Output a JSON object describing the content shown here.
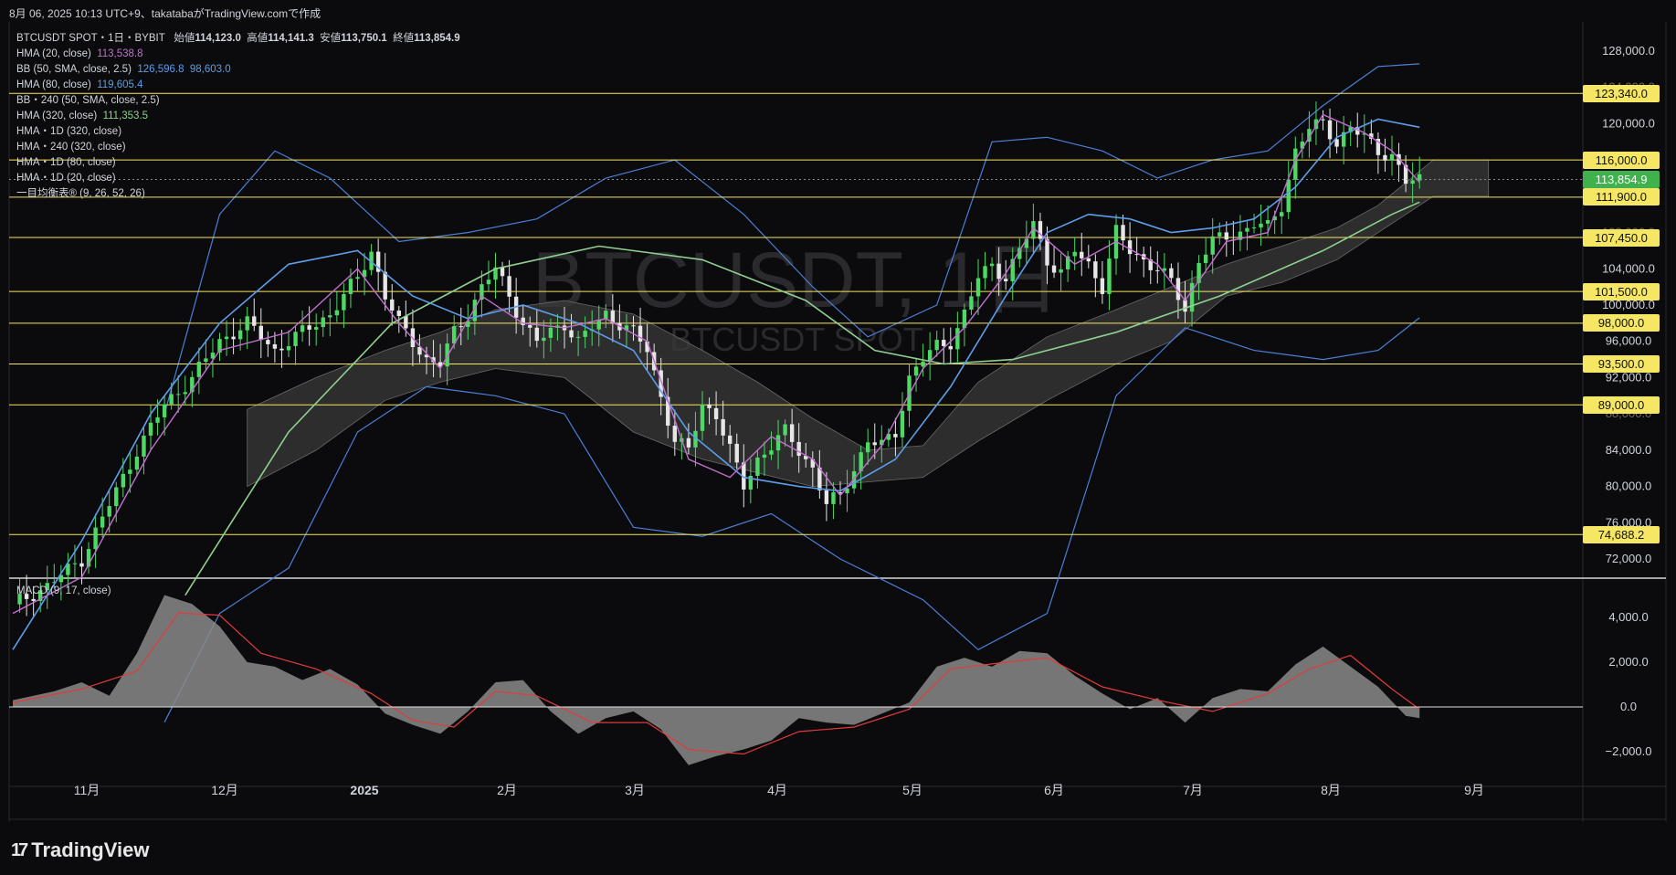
{
  "header": {
    "title": "8月 06, 2025 10:13 UTC+9、takatabaがTradingView.comで作成"
  },
  "symbol": {
    "name": "BTCUSDT SPOT・1日・BYBIT",
    "open_label": "始値",
    "open": "114,123.0",
    "high_label": "高値",
    "high": "114,141.3",
    "low_label": "安値",
    "low": "113,750.1",
    "close_label": "終値",
    "close": "113,854.9"
  },
  "watermark": {
    "main": "BTCUSDT, 1日",
    "sub": "BTCUSDT SPOT"
  },
  "indicators": [
    {
      "label": "HMA (20, close)",
      "value": "113,538.8",
      "color": "#c46fd0"
    },
    {
      "label": "BB (50, SMA, close, 2.5)",
      "value": "126,596.8",
      "value2": "98,603.0",
      "color": "#5c9ee8"
    },
    {
      "label": "HMA (80, close)",
      "value": "119,605.4",
      "color": "#5c9ee8"
    },
    {
      "label": "BB・240 (50, SMA, close, 2.5)",
      "value": ""
    },
    {
      "label": "HMA (320, close)",
      "value": "111,353.5",
      "color": "#8fd18f"
    },
    {
      "label": "HMA・1D (320, close)",
      "value": ""
    },
    {
      "label": "HMA・240 (320, close)",
      "value": ""
    },
    {
      "label": "HMA・1D (80, close)",
      "value": ""
    },
    {
      "label": "HMA・1D (20, close)",
      "value": ""
    },
    {
      "label": "一目均衡表® (9, 26, 52, 26)",
      "value": ""
    }
  ],
  "macd": {
    "label": "MACD (9, 17, close)"
  },
  "branding": {
    "logo": "TradingView",
    "mark": "17"
  },
  "colors": {
    "up": "#4cd964",
    "down": "#e6e6e6",
    "hline": "#f5e663",
    "hma20": "#c46fd0",
    "hma80": "#5c9ee8",
    "hma320": "#8fd18f",
    "bb": "#4b7fd6",
    "cloud": "#3a3a3a",
    "macd_hist": "#8a8a8a",
    "macd_signal": "#e23b3b"
  },
  "chart_data": {
    "type": "candlestick",
    "y_axis_ticks": [
      "128,000.0",
      "120,000.0",
      "104,000.0",
      "100,000.0",
      "96,000.0",
      "92,000.0",
      "84,000.0",
      "80,000.0",
      "76,000.0",
      "72,000.0"
    ],
    "y_axis_partial": [
      "124,000.0",
      "108,000.0",
      "88,000.0"
    ],
    "horizontal_levels": [
      "123,340.0",
      "116,000.0",
      "111,900.0",
      "107,450.0",
      "101,500.0",
      "98,000.0",
      "93,500.0",
      "89,000.0",
      "74,688.2"
    ],
    "current_price": "113,854.9",
    "x_axis_labels": [
      "11月",
      "12月",
      "2025",
      "2月",
      "3月",
      "4月",
      "5月",
      "6月",
      "7月",
      "8月",
      "9月"
    ],
    "macd_ticks": [
      "4,000.0",
      "2,000.0",
      "0.0",
      "−2,000.0"
    ],
    "close_path": [
      [
        0,
        67000
      ],
      [
        5,
        69000
      ],
      [
        10,
        72000
      ],
      [
        14,
        78000
      ],
      [
        18,
        84000
      ],
      [
        22,
        89000
      ],
      [
        26,
        92000
      ],
      [
        30,
        96000
      ],
      [
        34,
        98000
      ],
      [
        38,
        95000
      ],
      [
        42,
        97000
      ],
      [
        46,
        99000
      ],
      [
        50,
        103000
      ],
      [
        52,
        106000
      ],
      [
        54,
        101000
      ],
      [
        56,
        98000
      ],
      [
        58,
        96000
      ],
      [
        60,
        94000
      ],
      [
        62,
        93500
      ],
      [
        64,
        97000
      ],
      [
        66,
        99000
      ],
      [
        68,
        102000
      ],
      [
        70,
        104000
      ],
      [
        72,
        101000
      ],
      [
        74,
        98000
      ],
      [
        76,
        96000
      ],
      [
        78,
        97000
      ],
      [
        80,
        98000
      ],
      [
        82,
        96000
      ],
      [
        84,
        97500
      ],
      [
        86,
        99000
      ],
      [
        88,
        98000
      ],
      [
        90,
        97000
      ],
      [
        92,
        95000
      ],
      [
        94,
        90000
      ],
      [
        96,
        85000
      ],
      [
        98,
        84000
      ],
      [
        100,
        89000
      ],
      [
        102,
        88000
      ],
      [
        104,
        84000
      ],
      [
        106,
        80000
      ],
      [
        108,
        83000
      ],
      [
        110,
        84500
      ],
      [
        112,
        86000
      ],
      [
        114,
        84000
      ],
      [
        116,
        82000
      ],
      [
        118,
        78000
      ],
      [
        120,
        79000
      ],
      [
        122,
        82000
      ],
      [
        124,
        85000
      ],
      [
        126,
        84500
      ],
      [
        128,
        86000
      ],
      [
        130,
        92000
      ],
      [
        132,
        94000
      ],
      [
        134,
        95500
      ],
      [
        136,
        96000
      ],
      [
        138,
        99000
      ],
      [
        140,
        103000
      ],
      [
        142,
        104500
      ],
      [
        144,
        103000
      ],
      [
        146,
        106000
      ],
      [
        148,
        109000
      ],
      [
        150,
        105000
      ],
      [
        152,
        103500
      ],
      [
        154,
        106000
      ],
      [
        156,
        104500
      ],
      [
        158,
        102000
      ],
      [
        160,
        108000
      ],
      [
        162,
        106000
      ],
      [
        164,
        105000
      ],
      [
        166,
        104000
      ],
      [
        168,
        102500
      ],
      [
        170,
        99500
      ],
      [
        172,
        105000
      ],
      [
        174,
        107000
      ],
      [
        176,
        107500
      ],
      [
        178,
        108000
      ],
      [
        180,
        109000
      ],
      [
        182,
        108500
      ],
      [
        184,
        111000
      ],
      [
        186,
        117000
      ],
      [
        188,
        119500
      ],
      [
        190,
        120000
      ],
      [
        192,
        118000
      ],
      [
        194,
        119500
      ],
      [
        196,
        118500
      ],
      [
        198,
        117000
      ],
      [
        200,
        116500
      ],
      [
        202,
        113500
      ],
      [
        204,
        113854.9
      ]
    ],
    "hma20_path": [
      [
        0,
        66000
      ],
      [
        10,
        70000
      ],
      [
        20,
        84000
      ],
      [
        30,
        95000
      ],
      [
        40,
        97000
      ],
      [
        50,
        104000
      ],
      [
        56,
        98000
      ],
      [
        62,
        93000
      ],
      [
        68,
        101000
      ],
      [
        74,
        98000
      ],
      [
        80,
        97500
      ],
      [
        86,
        98500
      ],
      [
        92,
        96000
      ],
      [
        98,
        83000
      ],
      [
        104,
        81000
      ],
      [
        110,
        85500
      ],
      [
        116,
        83000
      ],
      [
        120,
        79000
      ],
      [
        126,
        84500
      ],
      [
        132,
        93000
      ],
      [
        138,
        97500
      ],
      [
        144,
        103500
      ],
      [
        148,
        108500
      ],
      [
        154,
        104500
      ],
      [
        160,
        107000
      ],
      [
        166,
        104500
      ],
      [
        170,
        100500
      ],
      [
        176,
        107000
      ],
      [
        182,
        108000
      ],
      [
        186,
        116000
      ],
      [
        190,
        121000
      ],
      [
        196,
        119000
      ],
      [
        200,
        117000
      ],
      [
        204,
        113538.8
      ]
    ],
    "hma80_path": [
      [
        0,
        62000
      ],
      [
        10,
        74000
      ],
      [
        20,
        88000
      ],
      [
        30,
        98000
      ],
      [
        40,
        104500
      ],
      [
        50,
        106000
      ],
      [
        58,
        101000
      ],
      [
        66,
        98500
      ],
      [
        74,
        100000
      ],
      [
        82,
        98000
      ],
      [
        90,
        95000
      ],
      [
        98,
        86000
      ],
      [
        106,
        81000
      ],
      [
        114,
        80000
      ],
      [
        120,
        79500
      ],
      [
        128,
        83000
      ],
      [
        136,
        91000
      ],
      [
        144,
        101000
      ],
      [
        150,
        108000
      ],
      [
        156,
        110000
      ],
      [
        162,
        109500
      ],
      [
        168,
        108000
      ],
      [
        174,
        108500
      ],
      [
        180,
        109500
      ],
      [
        186,
        113000
      ],
      [
        192,
        118500
      ],
      [
        198,
        120500
      ],
      [
        204,
        119605.4
      ]
    ],
    "hma320_path": [
      [
        25,
        68000
      ],
      [
        40,
        86000
      ],
      [
        55,
        98000
      ],
      [
        70,
        104000
      ],
      [
        85,
        106500
      ],
      [
        100,
        105000
      ],
      [
        115,
        100500
      ],
      [
        125,
        95000
      ],
      [
        135,
        93500
      ],
      [
        145,
        94000
      ],
      [
        160,
        97000
      ],
      [
        175,
        101000
      ],
      [
        190,
        106000
      ],
      [
        200,
        110000
      ],
      [
        204,
        111353.5
      ]
    ],
    "bb_upper": [
      [
        22,
        88000
      ],
      [
        30,
        110000
      ],
      [
        38,
        117000
      ],
      [
        46,
        114000
      ],
      [
        56,
        107000
      ],
      [
        66,
        108000
      ],
      [
        76,
        109500
      ],
      [
        86,
        114000
      ],
      [
        96,
        116000
      ],
      [
        106,
        110000
      ],
      [
        116,
        102000
      ],
      [
        124,
        96500
      ],
      [
        134,
        100000
      ],
      [
        142,
        118000
      ],
      [
        150,
        118500
      ],
      [
        158,
        117000
      ],
      [
        166,
        114000
      ],
      [
        174,
        116000
      ],
      [
        182,
        117000
      ],
      [
        190,
        122000
      ],
      [
        198,
        126300
      ],
      [
        204,
        126596.8
      ]
    ],
    "bb_lower": [
      [
        22,
        54000
      ],
      [
        30,
        66000
      ],
      [
        40,
        71000
      ],
      [
        50,
        86000
      ],
      [
        60,
        91000
      ],
      [
        70,
        90000
      ],
      [
        80,
        88000
      ],
      [
        90,
        75500
      ],
      [
        100,
        74500
      ],
      [
        110,
        77000
      ],
      [
        120,
        72000
      ],
      [
        132,
        67500
      ],
      [
        140,
        62000
      ],
      [
        150,
        66000
      ],
      [
        160,
        90000
      ],
      [
        170,
        97500
      ],
      [
        180,
        95000
      ],
      [
        190,
        94000
      ],
      [
        198,
        95000
      ],
      [
        204,
        98603.0
      ]
    ],
    "cloud_upper": [
      [
        34,
        88500
      ],
      [
        44,
        92000
      ],
      [
        54,
        95000
      ],
      [
        62,
        97000
      ],
      [
        70,
        99500
      ],
      [
        80,
        100500
      ],
      [
        90,
        99000
      ],
      [
        100,
        95000
      ],
      [
        108,
        91500
      ],
      [
        116,
        87500
      ],
      [
        124,
        84000
      ],
      [
        132,
        84500
      ],
      [
        140,
        91500
      ],
      [
        150,
        96500
      ],
      [
        160,
        99500
      ],
      [
        168,
        102000
      ],
      [
        176,
        104500
      ],
      [
        184,
        106500
      ],
      [
        192,
        108500
      ],
      [
        198,
        111000
      ],
      [
        206,
        116000
      ],
      [
        214,
        116000
      ]
    ],
    "cloud_lower": [
      [
        34,
        80000
      ],
      [
        44,
        84000
      ],
      [
        54,
        89500
      ],
      [
        62,
        91500
      ],
      [
        70,
        93000
      ],
      [
        80,
        92000
      ],
      [
        90,
        86000
      ],
      [
        100,
        83000
      ],
      [
        108,
        81500
      ],
      [
        116,
        80000
      ],
      [
        124,
        80500
      ],
      [
        132,
        81000
      ],
      [
        140,
        85000
      ],
      [
        150,
        89500
      ],
      [
        160,
        93500
      ],
      [
        168,
        96000
      ],
      [
        176,
        101000
      ],
      [
        184,
        102500
      ],
      [
        192,
        105000
      ],
      [
        198,
        108000
      ],
      [
        206,
        112000
      ],
      [
        214,
        112000
      ]
    ],
    "macd_path": [
      [
        0,
        300
      ],
      [
        6,
        700
      ],
      [
        10,
        1100
      ],
      [
        14,
        500
      ],
      [
        18,
        2400
      ],
      [
        22,
        5000
      ],
      [
        26,
        4600
      ],
      [
        30,
        3600
      ],
      [
        34,
        2000
      ],
      [
        38,
        1800
      ],
      [
        42,
        1200
      ],
      [
        46,
        1700
      ],
      [
        50,
        1000
      ],
      [
        54,
        -300
      ],
      [
        58,
        -800
      ],
      [
        62,
        -1200
      ],
      [
        66,
        -200
      ],
      [
        70,
        1100
      ],
      [
        74,
        1200
      ],
      [
        78,
        -200
      ],
      [
        82,
        -1200
      ],
      [
        86,
        -500
      ],
      [
        90,
        -200
      ],
      [
        94,
        -1000
      ],
      [
        98,
        -2600
      ],
      [
        102,
        -2200
      ],
      [
        106,
        -1900
      ],
      [
        110,
        -1500
      ],
      [
        114,
        -500
      ],
      [
        118,
        -700
      ],
      [
        122,
        -800
      ],
      [
        126,
        -300
      ],
      [
        130,
        200
      ],
      [
        134,
        1800
      ],
      [
        138,
        2200
      ],
      [
        142,
        1800
      ],
      [
        146,
        2500
      ],
      [
        150,
        2400
      ],
      [
        154,
        1400
      ],
      [
        158,
        600
      ],
      [
        162,
        -100
      ],
      [
        166,
        400
      ],
      [
        170,
        -700
      ],
      [
        174,
        400
      ],
      [
        178,
        800
      ],
      [
        182,
        700
      ],
      [
        186,
        1900
      ],
      [
        190,
        2700
      ],
      [
        194,
        1800
      ],
      [
        198,
        900
      ],
      [
        202,
        -400
      ],
      [
        204,
        -500
      ]
    ],
    "signal_path": [
      [
        0,
        200
      ],
      [
        10,
        800
      ],
      [
        18,
        1600
      ],
      [
        24,
        4200
      ],
      [
        30,
        4100
      ],
      [
        36,
        2400
      ],
      [
        44,
        1700
      ],
      [
        52,
        600
      ],
      [
        58,
        -600
      ],
      [
        64,
        -900
      ],
      [
        70,
        700
      ],
      [
        76,
        500
      ],
      [
        84,
        -700
      ],
      [
        92,
        -700
      ],
      [
        98,
        -1900
      ],
      [
        106,
        -2100
      ],
      [
        114,
        -1100
      ],
      [
        122,
        -900
      ],
      [
        130,
        -100
      ],
      [
        136,
        1700
      ],
      [
        144,
        2000
      ],
      [
        150,
        2200
      ],
      [
        158,
        900
      ],
      [
        166,
        300
      ],
      [
        174,
        -200
      ],
      [
        182,
        600
      ],
      [
        188,
        1700
      ],
      [
        194,
        2300
      ],
      [
        200,
        800
      ],
      [
        204,
        -100
      ]
    ]
  }
}
